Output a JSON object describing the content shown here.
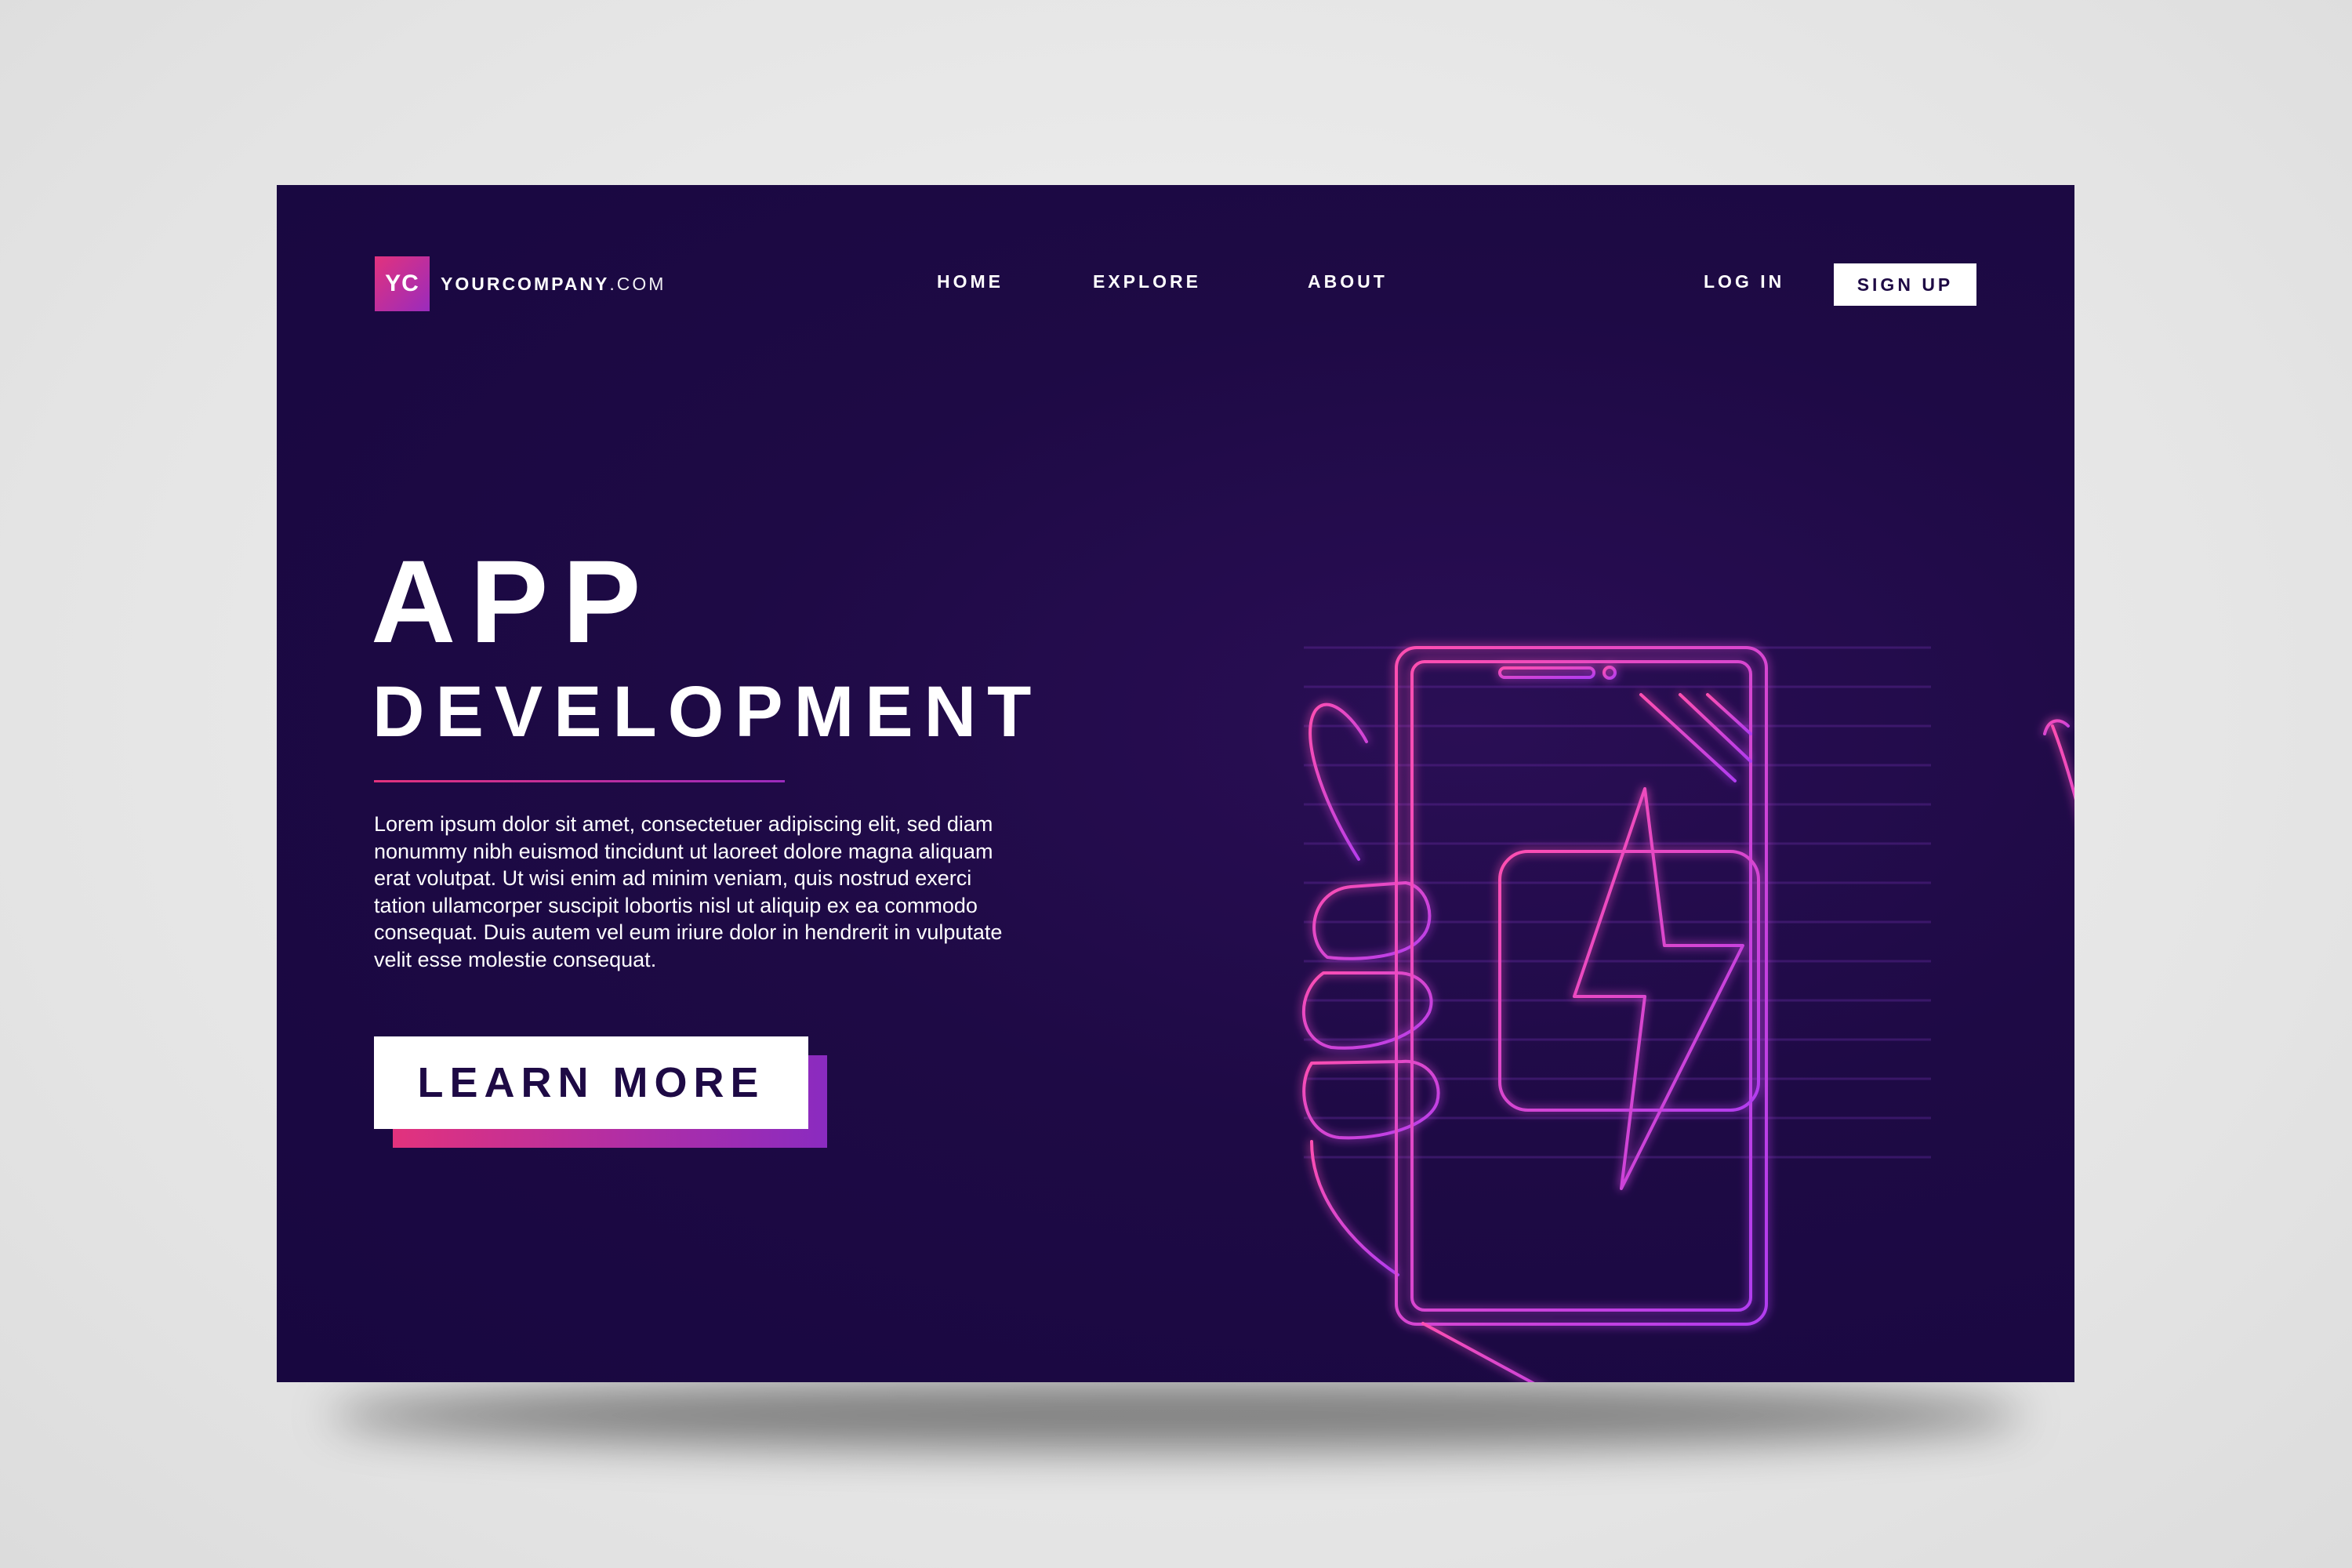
{
  "logo": {
    "badge": "YC",
    "name_bold": "YOURCOMPANY",
    "name_light": ".COM"
  },
  "nav": {
    "home": "HOME",
    "explore": "EXPLORE",
    "about": "ABOUT"
  },
  "auth": {
    "login": "LOG IN",
    "signup": "SIGN UP"
  },
  "hero": {
    "title_line1": "APP",
    "title_line2": "DEVELOPMENT",
    "body_lines": [
      "Lorem ipsum dolor sit amet, consectetuer adipiscing elit, sed diam",
      "nonummy nibh euismod tincidunt ut laoreet dolore magna aliquam",
      "erat volutpat. Ut wisi enim ad minim veniam, quis nostrud exerci",
      "tation ullamcorper suscipit lobortis nisl ut aliquip ex ea commodo",
      "consequat. Duis autem vel eum iriure dolor in hendrerit in vulputate",
      "velit esse molestie consequat."
    ],
    "cta": "LEARN MORE"
  },
  "colors": {
    "background": "#1e0a45",
    "page": "#e4e4e4",
    "accent_pink": "#e2327d",
    "accent_purple": "#9a2bbd",
    "neon": "#d93fd0"
  },
  "illustration": {
    "icons": [
      "hand-icon",
      "smartphone-icon",
      "lightning-bolt-icon",
      "sparkle-plus-icon"
    ]
  }
}
